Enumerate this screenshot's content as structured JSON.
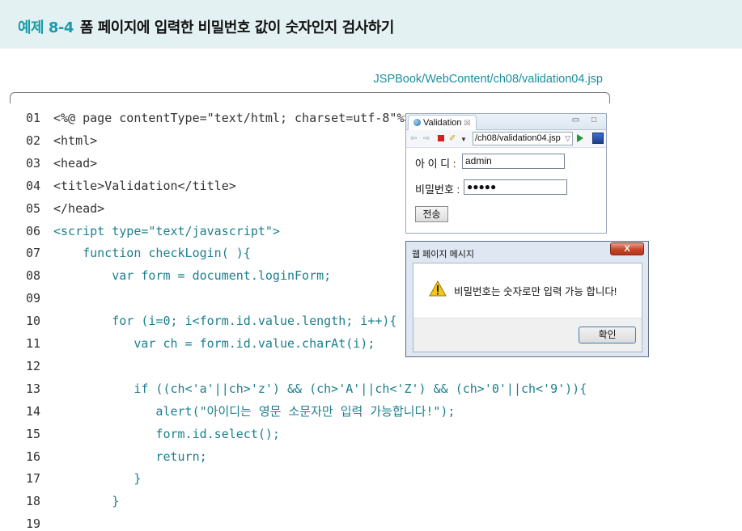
{
  "header": {
    "example_label": "예제 8-4",
    "title": "폼 페이지에 입력한 비밀번호 값이 숫자인지 검사하기"
  },
  "file_path": "JSPBook/WebContent/ch08/validation04.jsp",
  "code_lines": [
    {
      "num": "01",
      "text": "<%@ page contentType=\"text/html; charset=utf-8\"%>",
      "teal": false
    },
    {
      "num": "02",
      "text": "<html>",
      "teal": false
    },
    {
      "num": "03",
      "text": "<head>",
      "teal": false
    },
    {
      "num": "04",
      "text": "<title>Validation</title>",
      "teal": false
    },
    {
      "num": "05",
      "text": "</head>",
      "teal": false
    },
    {
      "num": "06",
      "text": "<script type=\"text/javascript\">",
      "teal": true
    },
    {
      "num": "07",
      "text": "    function checkLogin( ){",
      "teal": true
    },
    {
      "num": "08",
      "text": "        var form = document.loginForm;",
      "teal": true
    },
    {
      "num": "09",
      "text": "",
      "teal": true
    },
    {
      "num": "10",
      "text": "        for (i=0; i<form.id.value.length; i++){",
      "teal": true
    },
    {
      "num": "11",
      "text": "           var ch = form.id.value.charAt(i);",
      "teal": true
    },
    {
      "num": "12",
      "text": "",
      "teal": true
    },
    {
      "num": "13",
      "text": "           if ((ch<'a'||ch>'z') && (ch>'A'||ch<'Z') && (ch>'0'||ch<'9')){",
      "teal": true
    },
    {
      "num": "14",
      "text": "              alert(\"아이디는 영문 소문자만 입력 가능합니다!\");",
      "teal": true
    },
    {
      "num": "15",
      "text": "              form.id.select();",
      "teal": true
    },
    {
      "num": "16",
      "text": "              return;",
      "teal": true
    },
    {
      "num": "17",
      "text": "           }",
      "teal": true
    },
    {
      "num": "18",
      "text": "        }",
      "teal": true
    },
    {
      "num": "19",
      "text": "",
      "teal": true
    }
  ],
  "browser": {
    "tab_label": "Validation",
    "tab_close": "☒",
    "window_buttons": "▭ □",
    "url": "/ch08/validation04.jsp",
    "id_label": "아 이 디 :",
    "id_value": "admin",
    "pw_label": "비밀번호 :",
    "pw_value": "●●●●●",
    "submit_label": "전송"
  },
  "dialog": {
    "title": "웹 페이지 메시지",
    "close_label": "X",
    "message": "비밀번호는 숫자로만 입력 가능 합니다!",
    "ok_label": "확인"
  },
  "colors": {
    "accent": "#1a9ba9",
    "header_bg": "#e4f1f3",
    "code_teal": "#1c7f8d"
  }
}
